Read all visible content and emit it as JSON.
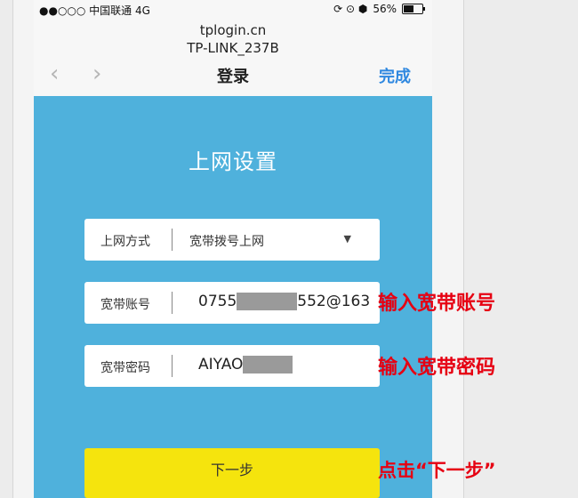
{
  "status_bar": {
    "carrier": "●●○○○ 中国联通 4G",
    "right_symbols": "⟳ ⊙ ⬢",
    "battery": "56%",
    "battery_level": 0.56
  },
  "browser": {
    "url": "tplogin.cn",
    "site_name": "TP-LINK_237B"
  },
  "nav": {
    "back_icon": "‹",
    "forward_icon": "›",
    "title": "登录",
    "done": "完成"
  },
  "form": {
    "title": "上网设置",
    "connection_type": {
      "label": "上网方式",
      "value": "宽带拨号上网",
      "dropdown_icon": "▼"
    },
    "account": {
      "label": "宽带账号",
      "value_prefix": "0755",
      "value_suffix": "552@163"
    },
    "password": {
      "label": "宽带密码",
      "value_prefix": "AIYAO"
    },
    "next_button": "下一步"
  },
  "annotations": {
    "account": "输入宽带账号",
    "password": "输入宽带密码",
    "next": "点击“下一步”"
  },
  "colors": {
    "content_bg": "#4fb1dc",
    "button_bg": "#f5e40d",
    "annotation": "#e60012",
    "done_link": "#2f88e0"
  }
}
